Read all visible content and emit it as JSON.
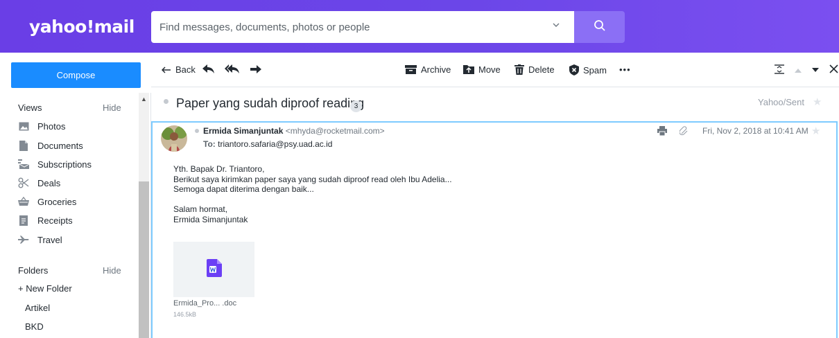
{
  "header": {
    "logo_text": "yahoo!mail",
    "search_placeholder": "Find messages, documents, photos or people"
  },
  "compose_label": "Compose",
  "sidebar": {
    "views_heading": "Views",
    "views_hide": "Hide",
    "views": [
      {
        "label": "Photos",
        "icon": "photo-icon"
      },
      {
        "label": "Documents",
        "icon": "document-icon"
      },
      {
        "label": "Subscriptions",
        "icon": "subscriptions-icon"
      },
      {
        "label": "Deals",
        "icon": "scissors-icon"
      },
      {
        "label": "Groceries",
        "icon": "basket-icon"
      },
      {
        "label": "Receipts",
        "icon": "receipt-icon"
      },
      {
        "label": "Travel",
        "icon": "plane-icon"
      }
    ],
    "folders_heading": "Folders",
    "folders_hide": "Hide",
    "new_folder": "+ New Folder",
    "folders": [
      "Artikel",
      "BKD"
    ]
  },
  "toolbar": {
    "back": "Back",
    "archive": "Archive",
    "move": "Move",
    "delete": "Delete",
    "spam": "Spam",
    "more": "•••"
  },
  "message": {
    "subject": "Paper yang sudah diproof reading",
    "count": "3",
    "folder_path": "Yahoo/Sent",
    "sender_name": "Ermida Simanjuntak",
    "sender_email": "<mhyda@rocketmail.com>",
    "to_label": "To:",
    "to_address": "triantoro.safaria@psy.uad.ac.id",
    "date": "Fri, Nov 2, 2018 at 10:41 AM",
    "body_lines": [
      "Yth. Bapak Dr. Triantoro,",
      "Berikut saya kirimkan paper saya yang sudah diproof read oleh Ibu Adelia...",
      "Semoga dapat diterima dengan baik...",
      "",
      "Salam hormat,",
      "Ermida Simanjuntak"
    ],
    "attachment": {
      "name": "Ermida_Pro... .doc",
      "size": "146.5kB",
      "icon": "word-doc-icon"
    }
  },
  "colors": {
    "header_purple": "#6a3ee6",
    "search_button": "#8b6ff5",
    "compose_blue": "#1a8cff",
    "selected_border": "#7dcbff"
  }
}
